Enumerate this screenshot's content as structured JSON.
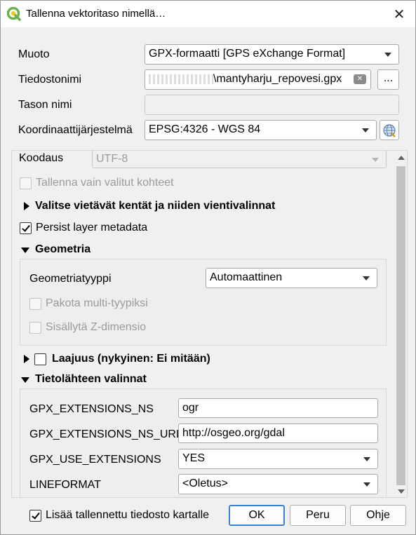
{
  "window": {
    "title": "Tallenna vektoritaso nimellä…",
    "close_glyph": "✕"
  },
  "form": {
    "format_label": "Muoto",
    "format_value": "GPX-formaatti [GPS eXchange Format]",
    "filename_label": "Tiedostonimi",
    "filename_value": "\\mantyharju_repovesi.gpx",
    "browse_label": "...",
    "layername_label": "Tason nimi",
    "layername_value": "",
    "crs_label": "Koordinaattijärjestelmä",
    "crs_value": "EPSG:4326 - WGS 84"
  },
  "options": {
    "encoding_label": "Koodaus",
    "encoding_value": "UTF-8",
    "selected_only_label": "Tallenna vain valitut kohteet",
    "select_fields_label": "Valitse vietävät kentät ja niiden vientivalinnat",
    "persist_metadata_label": "Persist layer metadata",
    "geometry_section_label": "Geometria",
    "geometry_type_label": "Geometriatyyppi",
    "geometry_type_value": "Automaattinen",
    "force_multi_label": "Pakota multi-tyypiksi",
    "include_z_label": "Sisällytä Z-dimensio",
    "extent_label": "Laajuus (nykyinen: Ei mitään)",
    "datasource_section_label": "Tietolähteen valinnat",
    "datasource_options": [
      {
        "name": "GPX_EXTENSIONS_NS",
        "value": "ogr",
        "kind": "text"
      },
      {
        "name": "GPX_EXTENSIONS_NS_URL",
        "value": "http://osgeo.org/gdal",
        "kind": "text"
      },
      {
        "name": "GPX_USE_EXTENSIONS",
        "value": "YES",
        "kind": "combo"
      },
      {
        "name": "LINEFORMAT",
        "value": "<Oletus>",
        "kind": "combo"
      }
    ]
  },
  "footer": {
    "add_to_map_label": "Lisää tallennettu tiedosto kartalle",
    "ok_label": "OK",
    "cancel_label": "Peru",
    "help_label": "Ohje"
  },
  "colors": {
    "accent": "#3c7fd6",
    "qgis_green": "#6ab04c",
    "qgis_yellow": "#f0c419"
  }
}
